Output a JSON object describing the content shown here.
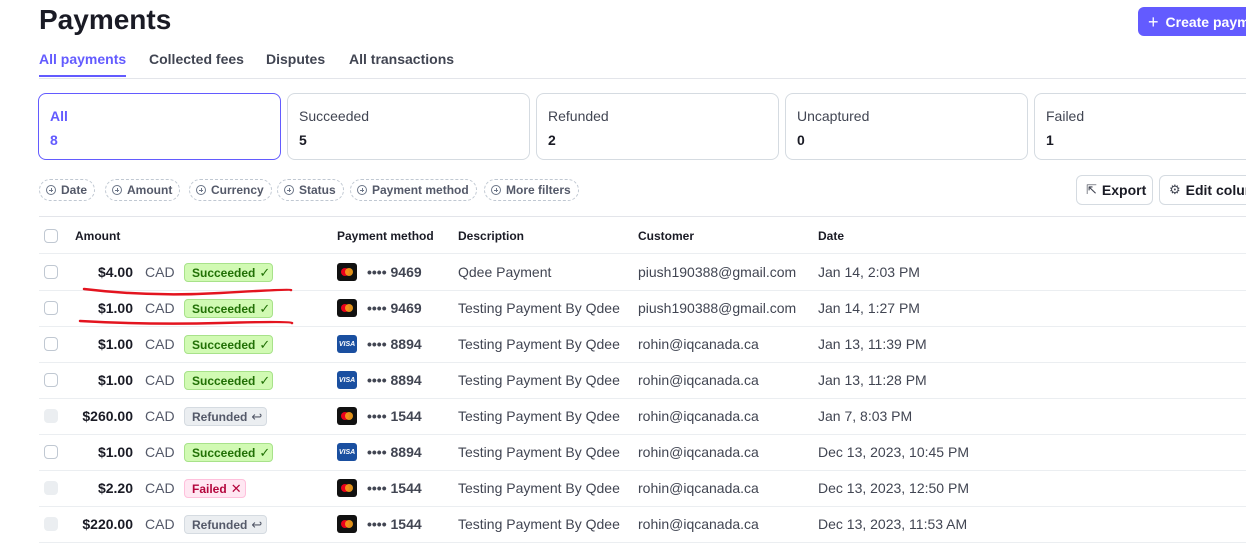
{
  "header": {
    "title": "Payments",
    "create_label": "Create payment"
  },
  "tabs": [
    {
      "label": "All payments",
      "active": true
    },
    {
      "label": "Collected fees",
      "active": false
    },
    {
      "label": "Disputes",
      "active": false
    },
    {
      "label": "All transactions",
      "active": false
    }
  ],
  "status_cards": [
    {
      "label": "All",
      "count": "8",
      "active": true
    },
    {
      "label": "Succeeded",
      "count": "5",
      "active": false
    },
    {
      "label": "Refunded",
      "count": "2",
      "active": false
    },
    {
      "label": "Uncaptured",
      "count": "0",
      "active": false
    },
    {
      "label": "Failed",
      "count": "1",
      "active": false
    }
  ],
  "filters": [
    "Date",
    "Amount",
    "Currency",
    "Status",
    "Payment method",
    "More filters"
  ],
  "toolbar": {
    "export_label": "Export",
    "edit_columns_label": "Edit columns"
  },
  "table": {
    "columns": [
      "Amount",
      "Payment method",
      "Description",
      "Customer",
      "Date"
    ],
    "rows": [
      {
        "amount": "$4.00",
        "currency": "CAD",
        "status": "Succeeded",
        "card_brand": "mastercard",
        "last4": "•••• 9469",
        "description": "Qdee Payment",
        "customer": "piush190388@gmail.com",
        "date": "Jan 14, 2:03 PM"
      },
      {
        "amount": "$1.00",
        "currency": "CAD",
        "status": "Succeeded",
        "card_brand": "mastercard",
        "last4": "•••• 9469",
        "description": "Testing Payment By Qdee",
        "customer": "piush190388@gmail.com",
        "date": "Jan 14, 1:27 PM"
      },
      {
        "amount": "$1.00",
        "currency": "CAD",
        "status": "Succeeded",
        "card_brand": "visa",
        "last4": "•••• 8894",
        "description": "Testing Payment By Qdee",
        "customer": "rohin@iqcanada.ca",
        "date": "Jan 13, 11:39 PM"
      },
      {
        "amount": "$1.00",
        "currency": "CAD",
        "status": "Succeeded",
        "card_brand": "visa",
        "last4": "•••• 8894",
        "description": "Testing Payment By Qdee",
        "customer": "rohin@iqcanada.ca",
        "date": "Jan 13, 11:28 PM"
      },
      {
        "amount": "$260.00",
        "currency": "CAD",
        "status": "Refunded",
        "card_brand": "mastercard",
        "last4": "•••• 1544",
        "description": "Testing Payment By Qdee",
        "customer": "rohin@iqcanada.ca",
        "date": "Jan 7, 8:03 PM"
      },
      {
        "amount": "$1.00",
        "currency": "CAD",
        "status": "Succeeded",
        "card_brand": "visa",
        "last4": "•••• 8894",
        "description": "Testing Payment By Qdee",
        "customer": "rohin@iqcanada.ca",
        "date": "Dec 13, 2023, 10:45 PM"
      },
      {
        "amount": "$2.20",
        "currency": "CAD",
        "status": "Failed",
        "card_brand": "mastercard",
        "last4": "•••• 1544",
        "description": "Testing Payment By Qdee",
        "customer": "rohin@iqcanada.ca",
        "date": "Dec 13, 2023, 12:50 PM"
      },
      {
        "amount": "$220.00",
        "currency": "CAD",
        "status": "Refunded",
        "card_brand": "mastercard",
        "last4": "•••• 1544",
        "description": "Testing Payment By Qdee",
        "customer": "rohin@iqcanada.ca",
        "date": "Dec 13, 2023, 11:53 AM"
      }
    ]
  },
  "colors": {
    "accent": "#635bff",
    "succeeded": "#217005",
    "failed": "#b3063d",
    "annotation": "#e3141f"
  }
}
